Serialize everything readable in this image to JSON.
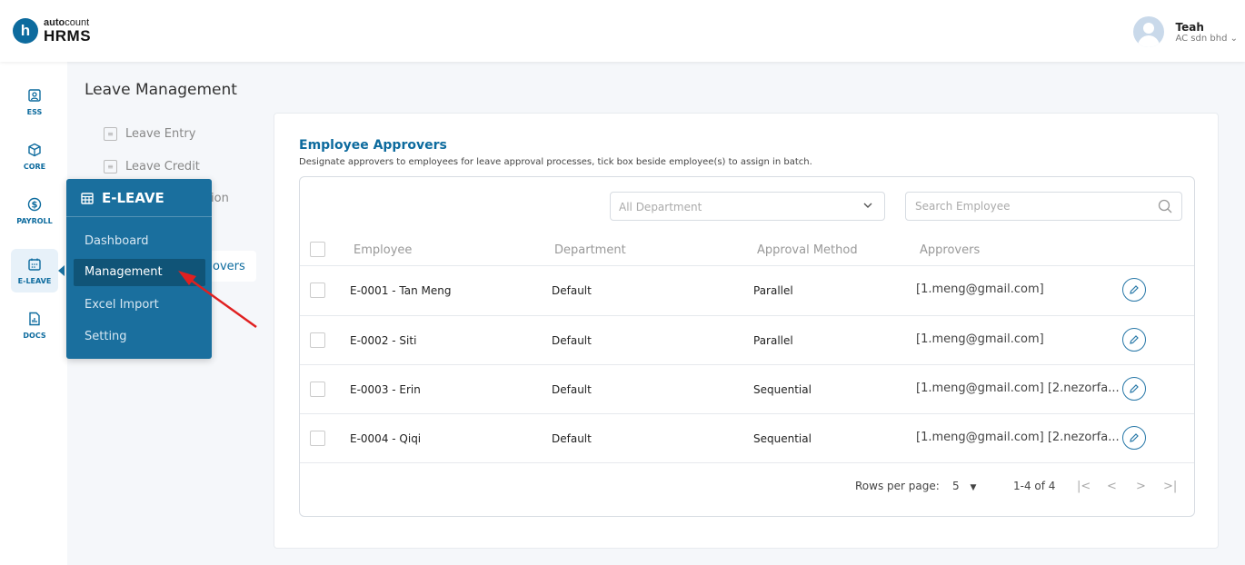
{
  "brand": {
    "sup_pre": "auto",
    "sup_main": "count",
    "main": "HRMS",
    "initial": "h"
  },
  "user": {
    "name": "Teah",
    "company": "AC sdn bhd"
  },
  "rail": [
    {
      "label": "ESS",
      "icon": "ess-icon"
    },
    {
      "label": "CORE",
      "icon": "core-icon"
    },
    {
      "label": "PAYROLL",
      "icon": "payroll-icon"
    },
    {
      "label": "E-LEAVE",
      "icon": "e-leave-icon"
    },
    {
      "label": "DOCS",
      "icon": "docs-icon"
    }
  ],
  "section": {
    "title": "Leave Management",
    "items": [
      "Leave Entry",
      "Leave Credit",
      "ion",
      "overs"
    ]
  },
  "flyout": {
    "title": "E-LEAVE",
    "items": [
      "Dashboard",
      "Management",
      "Excel Import",
      "Setting"
    ]
  },
  "card": {
    "title": "Employee Approvers",
    "description": "Designate approvers to employees for leave approval processes, tick box beside employee(s) to assign in batch."
  },
  "filters": {
    "department_value": "All Department",
    "search_placeholder": "Search Employee"
  },
  "table": {
    "columns": [
      "Employee",
      "Department",
      "Approval Method",
      "Approvers"
    ],
    "rows": [
      {
        "employee": "E-0001 - Tan Meng",
        "department": "Default",
        "method": "Parallel",
        "approvers": "[1.meng@gmail.com]"
      },
      {
        "employee": "E-0002 - Siti",
        "department": "Default",
        "method": "Parallel",
        "approvers": "[1.meng@gmail.com]"
      },
      {
        "employee": "E-0003 - Erin",
        "department": "Default",
        "method": "Sequential",
        "approvers": "[1.meng@gmail.com] [2.nezorfa..."
      },
      {
        "employee": "E-0004 - Qiqi",
        "department": "Default",
        "method": "Sequential",
        "approvers": "[1.meng@gmail.com] [2.nezorfa..."
      }
    ]
  },
  "pagination": {
    "rows_label": "Rows per page:",
    "rows_value": "5",
    "range": "1-4 of 4",
    "first": "|<",
    "prev": "<",
    "next": ">",
    "last": ">|"
  },
  "colors": {
    "brand": "#0d6b9e",
    "flyout": "#1a6f9e",
    "flyout_selected": "#105477",
    "arrow": "#e02020"
  }
}
